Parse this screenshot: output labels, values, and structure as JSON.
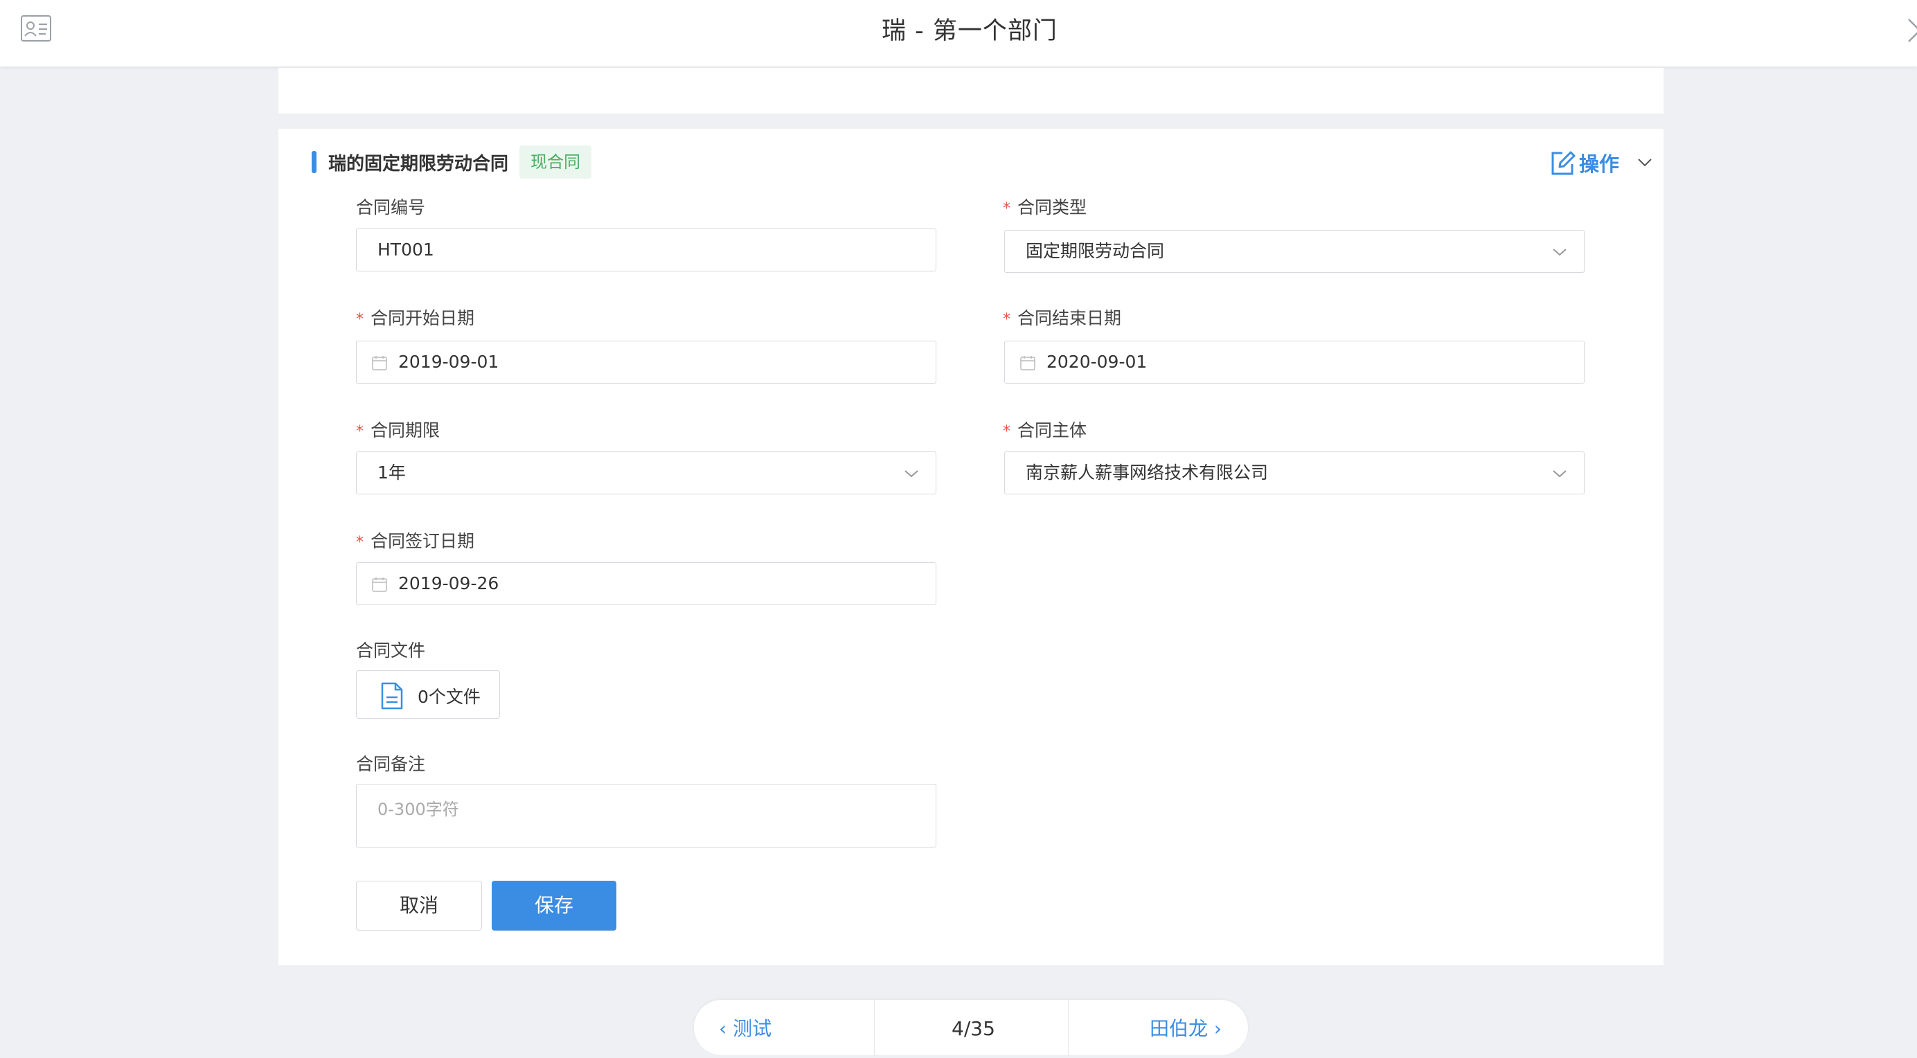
{
  "header": {
    "title": "瑞 - 第一个部门"
  },
  "contract": {
    "title": "瑞的固定期限劳动合同",
    "status_tag": "现合同",
    "ops_label": "操作"
  },
  "form": {
    "contract_no": {
      "label": "合同编号",
      "value": "HT001"
    },
    "contract_type": {
      "label": "合同类型",
      "value": "固定期限劳动合同"
    },
    "start_date": {
      "label": "合同开始日期",
      "value": "2019-09-01"
    },
    "end_date": {
      "label": "合同结束日期",
      "value": "2020-09-01"
    },
    "term": {
      "label": "合同期限",
      "value": "1年"
    },
    "entity": {
      "label": "合同主体",
      "value": "南京薪人薪事网络技术有限公司"
    },
    "sign_date": {
      "label": "合同签订日期",
      "value": "2019-09-26"
    },
    "files": {
      "label": "合同文件",
      "value": "0个文件"
    },
    "remark": {
      "label": "合同备注",
      "placeholder": "0-300字符"
    },
    "required_mark": "*"
  },
  "actions": {
    "cancel": "取消",
    "save": "保存"
  },
  "pager": {
    "prev": "测试",
    "count": "4/35",
    "next": "田伯龙"
  },
  "colors": {
    "accent": "#3b8de3",
    "tag_text": "#4cae64",
    "tag_bg": "#ebf7ee",
    "required": "#e5534b"
  },
  "icons": {
    "profile": "profile-card-icon",
    "close": "close-icon",
    "edit": "edit-icon",
    "calendar": "calendar-icon",
    "file": "file-icon"
  }
}
